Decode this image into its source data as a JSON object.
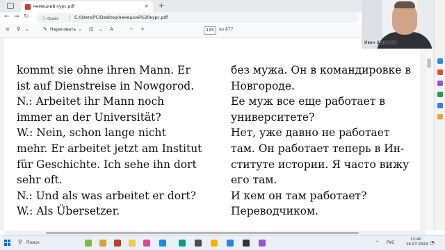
{
  "browser": {
    "tab_title": "немецкий курс.pdf",
    "tab_close": "×",
    "new_tab": "+",
    "file_label": "ⓘ Файл",
    "url": "C:/Users/PC/Desktop/немецкий%20курс.pdf",
    "back": "←",
    "forward": "→",
    "reload": "↻"
  },
  "pdf_toolbar": {
    "list_icon": "≡",
    "filter_icon": "⚲",
    "draw_label": "Нарисовать",
    "draw_icon": "✎",
    "chevron": "⌄",
    "eraser_icon": "◫",
    "aa_icon": "A",
    "page_current": "125",
    "page_total": "из 877",
    "zoom_out": "−",
    "zoom_in": "+"
  },
  "webcam": {
    "name": "Иван Шарлаев"
  },
  "document": {
    "left_lines": [
      "kommt sie ohne ihren Mann. Er",
      "ist auf Dienstreise in Nowgorod.",
      "N.: Arbeitet ihr Mann noch",
      "immer an der Universität?",
      "W.: Nein, schon lange nicht",
      "mehr. Er arbeitet jetzt am Institut",
      "für Geschichte.  Ich sehe ihn dort",
      "sehr oft.",
      "N.: Und als was arbeitet er dort?",
      "W.: Als Übersetzer."
    ],
    "right_lines": [
      "без мужа. Он в командировке в",
      "Новгороде.",
      "Ее муж все еще работает в",
      "университете?",
      "Нет, уже давно не работает",
      "там. Он работает теперь в Ин-",
      "ституте истории. Я часто вижу",
      "его там.",
      "И кем он там работает?",
      "Переводчиком."
    ]
  },
  "taskbar": {
    "search": "Поиск",
    "lang": "РУС",
    "time": "12:40",
    "date": "16.07.2024",
    "chevron_up": "⌃"
  },
  "colors": {
    "accent": "#0a6fd6",
    "pdf_red": "#d9362b"
  }
}
